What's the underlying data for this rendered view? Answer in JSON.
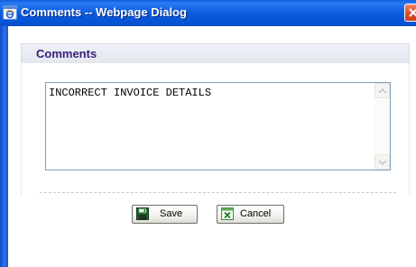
{
  "window": {
    "title": "Comments -- Webpage Dialog"
  },
  "section": {
    "title": "Comments"
  },
  "comment_field": {
    "value": "INCORRECT INVOICE DETAILS"
  },
  "buttons": {
    "save_label": "Save",
    "cancel_label": "Cancel"
  },
  "icons": {
    "title": "ie-page-icon",
    "close": "close-icon",
    "save": "floppy-disk-icon",
    "cancel": "excel-cancel-icon",
    "scroll_up": "scroll-up-arrow-icon",
    "scroll_down": "scroll-down-arrow-icon"
  },
  "colors": {
    "titlebar": "#0b5ce0",
    "section_title": "#3a1e7a",
    "close_button": "#e5532f"
  }
}
